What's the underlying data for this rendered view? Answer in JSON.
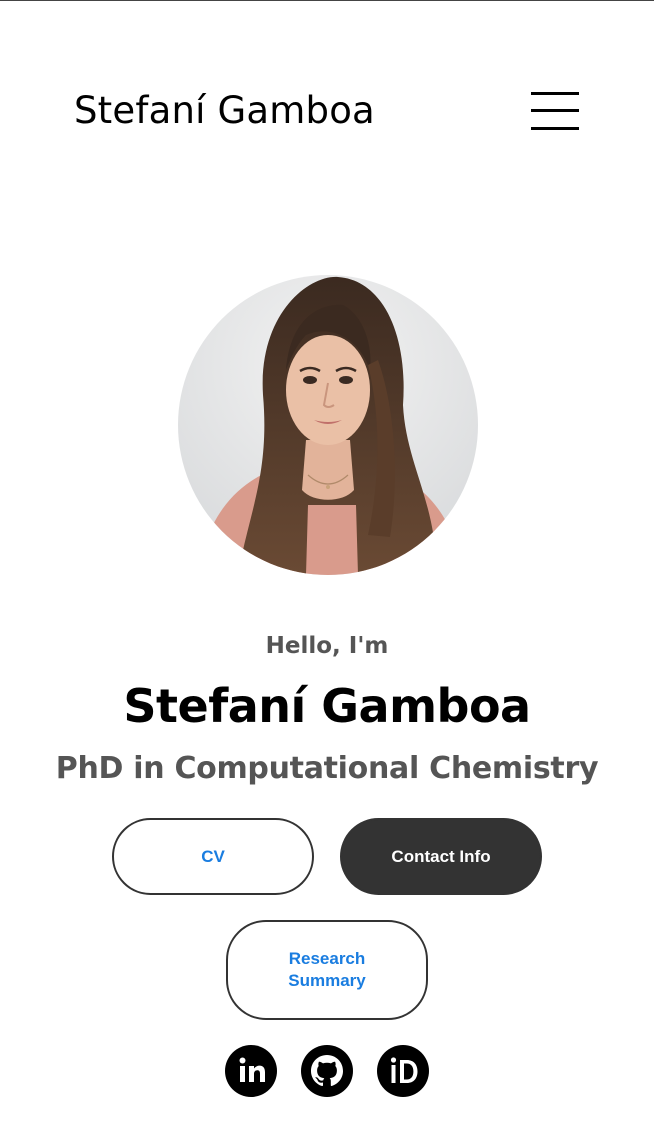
{
  "header": {
    "brand": "Stefaní Gamboa",
    "menu_icon": "hamburger-menu-icon"
  },
  "hero": {
    "avatar_alt": "profile-photo",
    "greeting": "Hello, I'm",
    "name": "Stefaní Gamboa",
    "subtitle": "PhD in Computational Chemistry"
  },
  "buttons": {
    "cv": "CV",
    "contact": "Contact Info",
    "research": "Research Summary"
  },
  "social": [
    {
      "icon": "linkedin-icon"
    },
    {
      "icon": "github-icon"
    },
    {
      "icon": "orcid-icon"
    }
  ],
  "colors": {
    "accent_link": "#1a7de0",
    "dark_button": "#333333",
    "muted_text": "#555555"
  }
}
